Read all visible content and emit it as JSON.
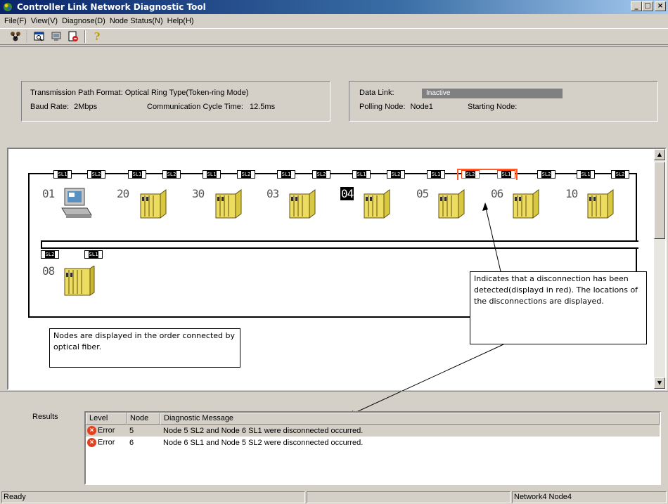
{
  "window": {
    "title": "Controller Link Network Diagnostic Tool",
    "controls": {
      "minimize": "_",
      "maximize": "□",
      "close": "×"
    }
  },
  "menu": [
    {
      "label": "File(F)"
    },
    {
      "label": "View(V)"
    },
    {
      "label": "Diagnose(D)"
    },
    {
      "label": "Node Status(N)"
    },
    {
      "label": "Help(H)"
    }
  ],
  "toolbar": {
    "icons": [
      "network-diagnose-icon",
      "search-window-icon",
      "monitor-icon",
      "report-icon",
      "help-icon"
    ],
    "help_glyph": "?"
  },
  "info": {
    "path_format_label": "Transmission Path Format:",
    "path_format_value": "Optical Ring Type(Token-ring Mode)",
    "baud_label": "Baud Rate:",
    "baud_value": "2Mbps",
    "cycle_label": "Communication Cycle Time:",
    "cycle_value": "12.5ms",
    "datalink_label": "Data Link:",
    "datalink_value": "Inactive",
    "polling_label": "Polling Node:",
    "polling_value": "Node1",
    "starting_label": "Starting Node:",
    "starting_value": ""
  },
  "network": {
    "sl1": "SL1",
    "sl2": "SL2",
    "nodes": [
      {
        "num": "01",
        "type": "pc"
      },
      {
        "num": "20",
        "type": "plc"
      },
      {
        "num": "30",
        "type": "plc"
      },
      {
        "num": "03",
        "type": "plc"
      },
      {
        "num": "04",
        "type": "plc",
        "selected": true
      },
      {
        "num": "05",
        "type": "plc"
      },
      {
        "num": "06",
        "type": "plc",
        "disconnected": true
      },
      {
        "num": "10",
        "type": "plc"
      },
      {
        "num": "08",
        "type": "plc"
      }
    ],
    "callout_nodes": "Nodes are displayed in the order connected by optical fiber.",
    "callout_disconnect": "Indicates that a disconnection has been detected(displayd in red). The locations of the disconnections are displayed."
  },
  "results": {
    "label": "Results",
    "columns": [
      "Level",
      "Node",
      "Diagnostic Message"
    ],
    "rows": [
      {
        "level": "Error",
        "node": "5",
        "message": "Node 5 SL2  and  Node 6 SL1 were disconnected occurred."
      },
      {
        "level": "Error",
        "node": "6",
        "message": "Node 6 SL1  and  Node 5 SL2 were disconnected occurred."
      }
    ]
  },
  "status": {
    "left": "Ready",
    "middle": "",
    "right": "Network4 Node4"
  },
  "colors": {
    "title_start": "#0a246a",
    "disconnect_red": "#ff5a2a",
    "error_icon": "#e0401e",
    "plc_yellow": "#e8d84a"
  }
}
